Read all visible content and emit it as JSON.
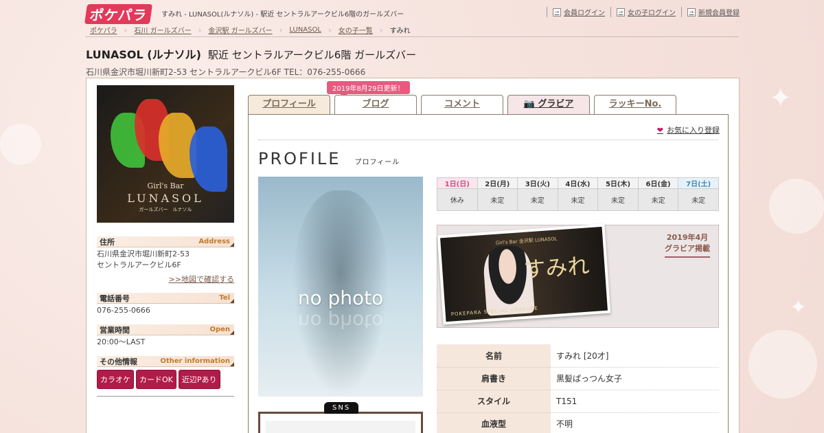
{
  "header": {
    "logo": "ポケパラ",
    "title": "すみれ - LUNASOL(ルナソル) - 駅近 セントラルアークビル6階のガールズバー",
    "links": [
      "会員ログイン",
      "女の子ログイン",
      "新規会員登録"
    ]
  },
  "breadcrumb": [
    "ポケパラ",
    "石川 ガールズバー",
    "金沢駅 ガールズバー",
    "LUNASOL",
    "女の子一覧",
    "すみれ"
  ],
  "shop": {
    "name": "LUNASOL (ルナソル)",
    "subtitle": "駅近 セントラルアークビル6階 ガールズバー",
    "address_line": "石川県金沢市堀川新町2-53 セントラルアークビル6F TEL：076-255-0666",
    "image_sign": [
      "Girl's Bar",
      "LUNASOL",
      "ガールズバー　ルナソル"
    ]
  },
  "sidebar": {
    "address": {
      "label": "住所",
      "en": "Address",
      "line1": "石川県金沢市堀川新町2-53",
      "line2": "セントラルアークビル6F",
      "map_link": ">>地図で確認する"
    },
    "tel": {
      "label": "電話番号",
      "en": "Tel",
      "value": "076-255-0666"
    },
    "open": {
      "label": "営業時間",
      "en": "Open",
      "value": "20:00～LAST"
    },
    "other": {
      "label": "その他情報",
      "en": "Other information",
      "tags": [
        "カラオケ",
        "カードOK",
        "近辺Pあり"
      ]
    }
  },
  "tabs": {
    "notice": "2019年8月29日更新！",
    "items": [
      "プロフィール",
      "ブログ",
      "コメント",
      "グラビア",
      "ラッキーNo."
    ]
  },
  "profile": {
    "favorite": "お気に入り登録",
    "heading": "PROFILE",
    "heading_jp": "プロフィール",
    "nophoto": "no photo",
    "sns_label": "SNS"
  },
  "schedule": {
    "days": [
      "1日(日)",
      "2日(月)",
      "3日(火)",
      "4日(水)",
      "5日(木)",
      "6日(金)",
      "7日(土)"
    ],
    "status": [
      "休み",
      "未定",
      "未定",
      "未定",
      "未定",
      "未定",
      "未定"
    ]
  },
  "gravure": {
    "date_line1": "2019年4月",
    "date_line2": "グラビア掲載",
    "name": "すみれ",
    "top_text": "Girl's Bar 金沢駅 LUNASOL",
    "bottom_text": "POKEPARA SPECIAL GRAVURE"
  },
  "details": [
    {
      "label": "名前",
      "value": "すみれ [20才]"
    },
    {
      "label": "肩書き",
      "value": "黒髪ぱっつん女子"
    },
    {
      "label": "スタイル",
      "value": "T151"
    },
    {
      "label": "血液型",
      "value": "不明"
    }
  ]
}
